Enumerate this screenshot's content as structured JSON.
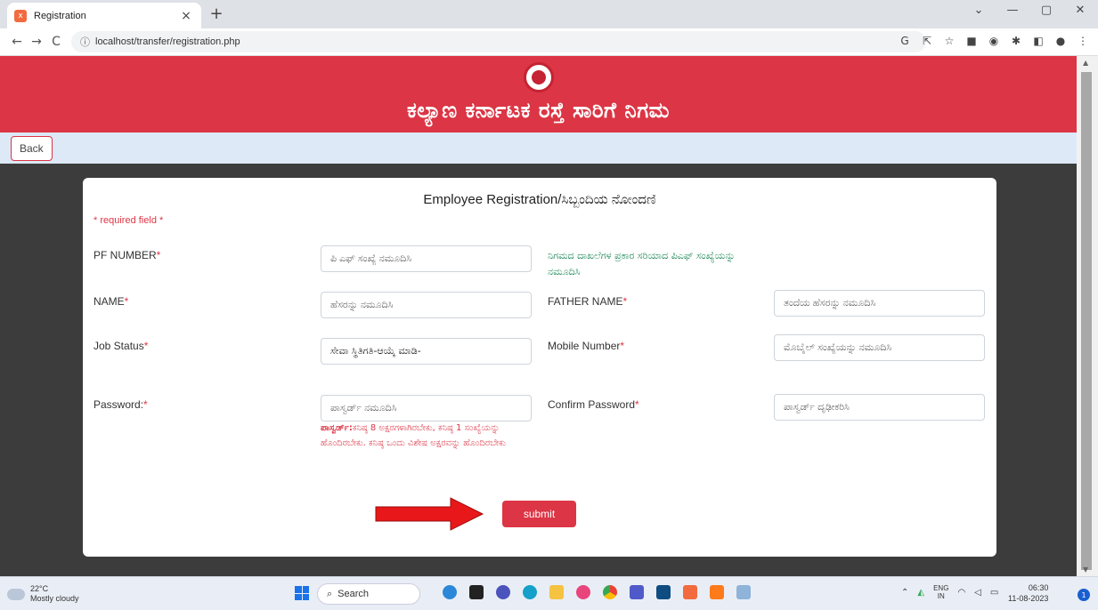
{
  "browser": {
    "tab_title": "Registration",
    "tab_close": "×",
    "new_tab": "+",
    "favicon": "x",
    "url": "localhost/transfer/registration.php",
    "window_controls": [
      "⌄",
      "—",
      "▢",
      "✕"
    ]
  },
  "header": {
    "title": "ಕಲ್ಯಾಣ ಕರ್ನಾಟಕ ರಸ್ತೆ ಸಾರಿಗೆ ನಿಗಮ",
    "emblem_icon": "ksrtc-emblem-icon"
  },
  "toolbar": {
    "back_label": "Back"
  },
  "form": {
    "title": "Employee Registration/ಸಿಬ್ಬಂದಿಯ ನೋಂದಣಿ",
    "required_note": "* required field *",
    "pf_number": {
      "label": "PF NUMBER",
      "placeholder": "ಪಿ ಎಫ್ ಸಂಖ್ಯೆ ನಮೂದಿಸಿ",
      "hint": "ನಿಗಮದ ದಾಖಲೆಗಳ ಪ್ರಕಾರ ಸರಿಯಾದ ಪಿಎಫ್ ಸಂಖ್ಯೆಯನ್ನು ನಮೂದಿಸಿ"
    },
    "name": {
      "label": "NAME",
      "placeholder": "ಹೆಸರನ್ನು ನಮೂದಿಸಿ"
    },
    "father_name": {
      "label": "FATHER NAME",
      "placeholder": "ತಂದೆಯ ಹೆಸರನ್ನು ನಮೂದಿಸಿ"
    },
    "job_status": {
      "label": "Job Status",
      "value": "ಸೇವಾ ಸ್ಥಿತಿಗತಿ-ಆಯ್ಕೆ ಮಾಡಿ-"
    },
    "mobile": {
      "label": "Mobile Number",
      "placeholder": "ಮೊಬೈಲ್ ಸಂಖ್ಯೆಯನ್ನು ನಮೂದಿಸಿ"
    },
    "password": {
      "label": "Password:",
      "placeholder": "ಪಾಸ್ವರ್ಡ್ ನಮೂದಿಸಿ",
      "hint_bold": "ಪಾಸ್ವರ್ಡ್:",
      "hint": "ಕನಿಷ್ಠ 8 ಅಕ್ಷರಗಳಾಗಿರಬೇಕು, ಕನಿಷ್ಠ 1 ಸಂಖ್ಯೆಯನ್ನು ಹೊಂದಿರಬೇಕು. ಕನಿಷ್ಠ ಒಂದು ವಿಶೇಷ ಅಕ್ಷರವನ್ನು ಹೊಂದಿರಬೇಕು"
    },
    "confirm_password": {
      "label": "Confirm Password",
      "placeholder": "ಪಾಸ್ವರ್ಡ್ ದೃಢೀಕರಿಸಿ"
    },
    "required_star": "*",
    "submit_label": "submit"
  },
  "taskbar": {
    "weather_temp": "22°C",
    "weather_desc": "Mostly cloudy",
    "search_label": "Search",
    "lang_line1": "ENG",
    "lang_line2": "IN",
    "time": "06:30",
    "date": "11-08-2023",
    "notification_count": "1"
  },
  "colors": {
    "brand_red": "#dc3545",
    "hint_green": "#198754",
    "page_dark": "#3c3c3c"
  }
}
